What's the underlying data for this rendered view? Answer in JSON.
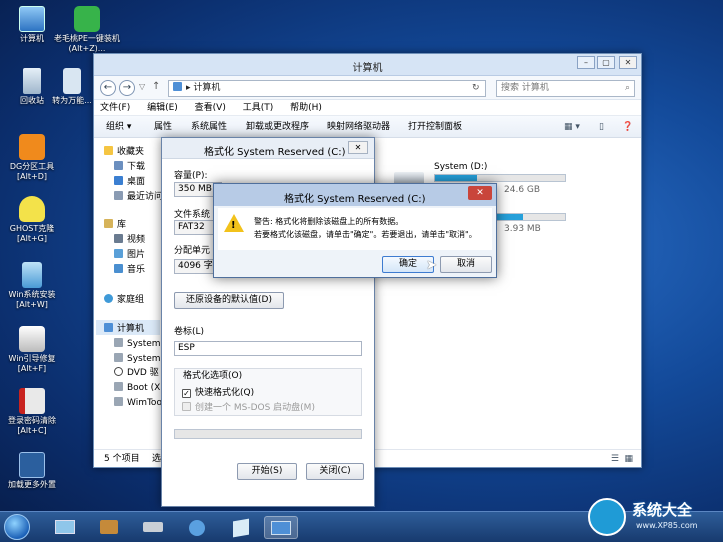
{
  "desktop_icons": [
    {
      "label": "计算机",
      "icon": "computer-icon"
    },
    {
      "label": "老毛桃PE一键装机(Alt+Z)...",
      "icon": "pe-installer-icon"
    },
    {
      "label": "回收站",
      "icon": "recycle-bin-icon"
    },
    {
      "label": "转为万能...",
      "icon": "convert-icon"
    },
    {
      "label": "DG分区工具[Alt+D]",
      "icon": "dg-partition-icon"
    },
    {
      "label": "GHOST克隆[Alt+G]",
      "icon": "ghost-icon"
    },
    {
      "label": "Win系统安装[Alt+W]",
      "icon": "win-install-icon"
    },
    {
      "label": "Win引导修复[Alt+F]",
      "icon": "boot-repair-icon"
    },
    {
      "label": "登录密码清除[Alt+C]",
      "icon": "password-clear-icon"
    },
    {
      "label": "加载更多外置",
      "icon": "load-more-icon"
    }
  ],
  "explorer": {
    "title": "计算机",
    "address": "计算机",
    "search_placeholder": "搜索 计算机",
    "menu": [
      "文件(F)",
      "编辑(E)",
      "查看(V)",
      "工具(T)",
      "帮助(H)"
    ],
    "toolbar": [
      "组织 ▾",
      "属性",
      "系统属性",
      "卸载或更改程序",
      "映射网络驱动器",
      "打开控制面板"
    ],
    "nav": {
      "favorites": "收藏夹",
      "downloads": "下载",
      "desktop": "桌面",
      "recent": "最近访问",
      "libraries": "库",
      "videos": "视频",
      "pictures": "图片",
      "music": "音乐",
      "homegroup": "家庭组",
      "computer": "计算机",
      "drive1": "System",
      "drive2": "System",
      "drive3": "DVD 驱",
      "drive4": "Boot (X",
      "drive5": "WimToo"
    },
    "drives": [
      {
        "name": "System (D:)",
        "free": "24.6 GB",
        "fill": 0.32
      },
      {
        "name": "",
        "free": "3.93 MB",
        "fill": 0.1
      }
    ],
    "status_count": "5 个项目",
    "status_sel": "选"
  },
  "format_dialog": {
    "title": "格式化 System Reserved (C:)",
    "capacity_label": "容量(P):",
    "capacity_value": "350 MB",
    "fs_label": "文件系统",
    "fs_value": "FAT32",
    "alloc_label": "分配单元",
    "alloc_value": "4096 字",
    "restore_button": "还原设备的默认值(D)",
    "volume_label": "卷标(L)",
    "volume_value": "ESP",
    "options_label": "格式化选项(O)",
    "quick_format": "快速格式化(Q)",
    "msdos_disk": "创建一个 MS-DOS 启动盘(M)",
    "start_button": "开始(S)",
    "close_button": "关闭(C)"
  },
  "alert": {
    "title": "格式化 System Reserved (C:)",
    "line1": "警告: 格式化将删除该磁盘上的所有数据。",
    "line2": "若要格式化该磁盘，请单击\"确定\"。若要退出，请单击\"取消\"。",
    "ok": "确定",
    "cancel": "取消"
  },
  "watermark": {
    "brand": "系统大全",
    "url": "www.XP85.com"
  }
}
